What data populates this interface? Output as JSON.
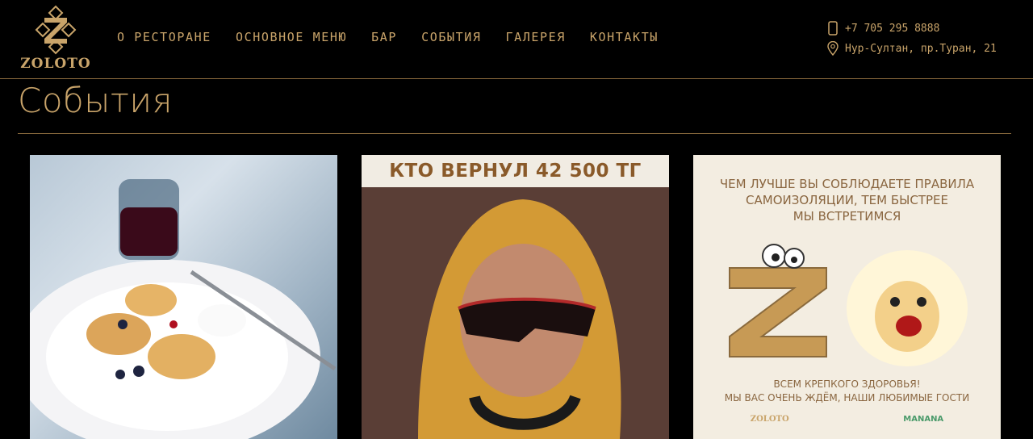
{
  "brand": {
    "name": "ZOLOTO"
  },
  "nav": {
    "items": [
      {
        "label": "О РЕСТОРАНЕ",
        "name": "nav-about"
      },
      {
        "label": "ОСНОВНОЕ МЕНЮ",
        "name": "nav-menu"
      },
      {
        "label": "БАР",
        "name": "nav-bar"
      },
      {
        "label": "СОБЫТИЯ",
        "name": "nav-events"
      },
      {
        "label": "ГАЛЕРЕЯ",
        "name": "nav-gallery"
      },
      {
        "label": "КОНТАКТЫ",
        "name": "nav-contacts"
      }
    ]
  },
  "contacts": {
    "phone": "+7 705 295 8888",
    "address": "Нур-Султан, пр.Туран, 21",
    "phone_icon": "phone-icon",
    "address_icon": "map-pin-icon"
  },
  "page": {
    "title": "События"
  },
  "cards": [
    {
      "name": "event-card-syrniki",
      "image": "syrniki-plate-photo"
    },
    {
      "name": "event-card-video",
      "banner": "КТО ВЕРНУЛ 42 500 ТГ",
      "image": "man-in-yellow-hoodie-photo"
    },
    {
      "name": "event-card-selfisolation",
      "lines": [
        "ЧЕМ ЛУЧШЕ ВЫ СОБЛЮДАЕТЕ ПРАВИЛА",
        "САМОИЗОЛЯЦИИ, ТЕМ БЫСТРЕЕ",
        "МЫ ВСТРЕТИМСЯ"
      ],
      "footer_lines": [
        "ВСЕМ КРЕПКОГО ЗДОРОВЬЯ!",
        "МЫ ВАС ОЧЕНЬ ЖДЁМ, НАШИ ЛЮБИМЫЕ ГОСТИ"
      ],
      "logos": [
        "ZOLOTO",
        "MANANA"
      ]
    }
  ],
  "colors": {
    "accent": "#c9a46a",
    "background": "#000000",
    "rule": "#8a6a3d"
  }
}
